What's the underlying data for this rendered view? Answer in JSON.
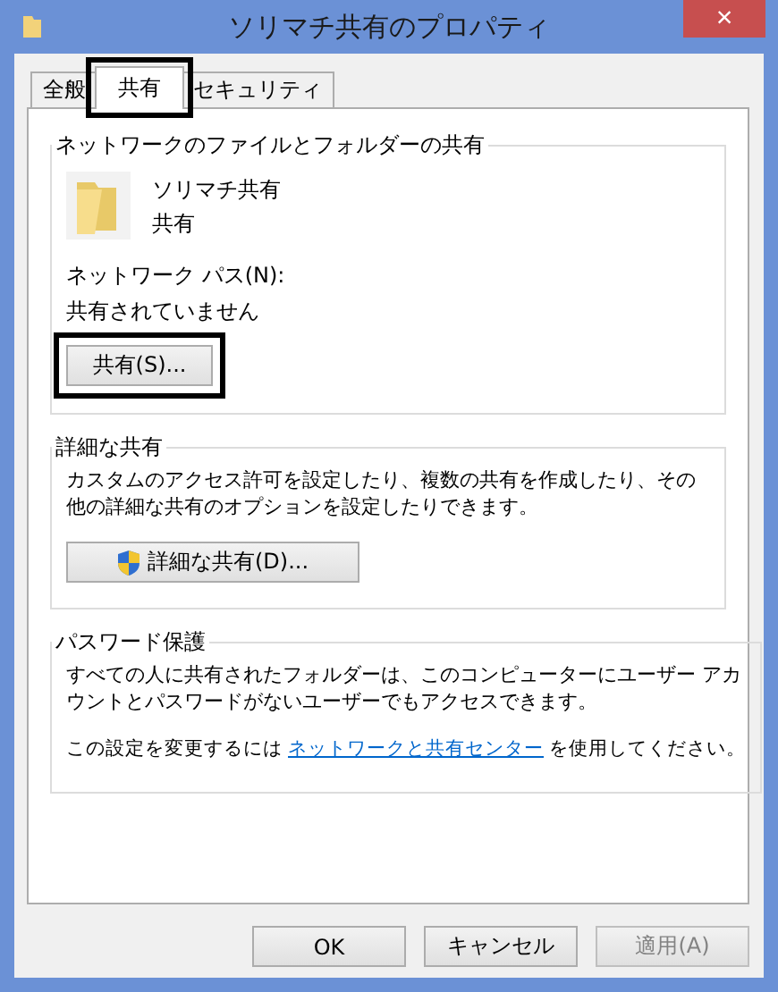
{
  "window": {
    "title": "ソリマチ共有のプロパティ",
    "close": "×"
  },
  "tabs": [
    {
      "label": "全般",
      "selected": false,
      "highlighted": false
    },
    {
      "label": "共有",
      "selected": true,
      "highlighted": true
    },
    {
      "label": "セキュリティ",
      "selected": false,
      "highlighted": false
    }
  ],
  "sections": [
    {
      "kind": "network",
      "title": "ネットワークのファイルとフォルダーの共有",
      "folder_name": "ソリマチ共有",
      "folder_state": "共有",
      "path_label": "ネットワーク パス(N):",
      "path_value": "共有されていません",
      "button": {
        "label": "共有(S)...",
        "highlighted": true
      }
    },
    {
      "kind": "advanced",
      "title": "詳細な共有",
      "description": "カスタムのアクセス許可を設定したり、複数の共有を作成したり、その他の詳細な共有のオプションを設定したりできます。",
      "button": {
        "label": "詳細な共有(D)..."
      }
    },
    {
      "kind": "password",
      "title": "パスワード保護",
      "description": "すべての人に共有されたフォルダーは、このコンピューターにユーザー アカウントとパスワードがないユーザーでもアクセスできます。",
      "link_prefix": "この設定を変更するには",
      "link": "ネットワークと共有センター",
      "link_suffix": "を使用してください。"
    }
  ],
  "buttons": [
    {
      "label": "OK",
      "disabled": false
    },
    {
      "label": "キャンセル",
      "disabled": false
    },
    {
      "label": "適用(A)",
      "disabled": true
    }
  ]
}
